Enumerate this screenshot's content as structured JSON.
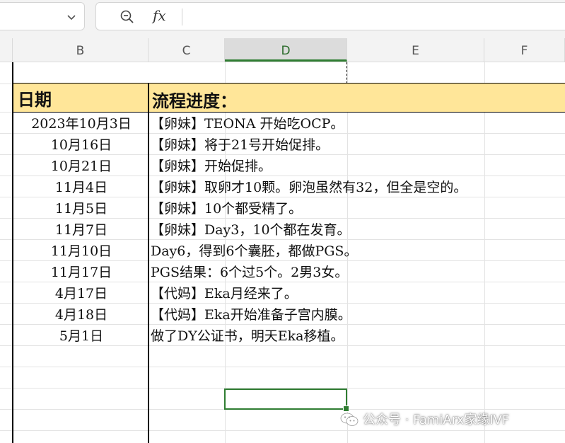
{
  "toolbar": {
    "name_box_value": "",
    "fx_label": "fx",
    "formula_value": ""
  },
  "columns": [
    {
      "letter": "B",
      "active": false
    },
    {
      "letter": "C",
      "active": false
    },
    {
      "letter": "D",
      "active": true
    },
    {
      "letter": "E",
      "active": false
    },
    {
      "letter": "F",
      "active": false
    }
  ],
  "table": {
    "header_date": "日期",
    "header_progress": "流程进度：",
    "header_color": "#ffe699",
    "rows": [
      {
        "date": "2023年10月3日",
        "progress": "【卵妹】TEONA 开始吃OCP。"
      },
      {
        "date": "10月16日",
        "progress": "【卵妹】将于21号开始促排。"
      },
      {
        "date": "10月21日",
        "progress": "【卵妹】开始促排。"
      },
      {
        "date": "11月4日",
        "progress": "【卵妹】取卵才10颗。卵泡虽然有32，但全是空的。"
      },
      {
        "date": "11月5日",
        "progress": "【卵妹】10个都受精了。"
      },
      {
        "date": "11月7日",
        "progress": "【卵妹】Day3，10个都在发育。"
      },
      {
        "date": "11月10日",
        "progress": "Day6，得到6个囊胚，都做PGS。"
      },
      {
        "date": "11月17日",
        "progress": "PGS结果：6个过5个。2男3女。"
      },
      {
        "date": "4月17日",
        "progress": "【代妈】Eka月经来了。"
      },
      {
        "date": "4月18日",
        "progress": "【代妈】Eka开始准备子宫内膜。"
      },
      {
        "date": "5月1日",
        "progress": "做了DY公证书，明天Eka移植。"
      }
    ]
  },
  "selection": {
    "color": "#2f7d32"
  },
  "watermark": {
    "text": "公众号 · FamiArx家缘IVF"
  },
  "icons": [
    "chevron-down-icon",
    "zoom-icon",
    "fx-icon",
    "wechat-icon"
  ]
}
